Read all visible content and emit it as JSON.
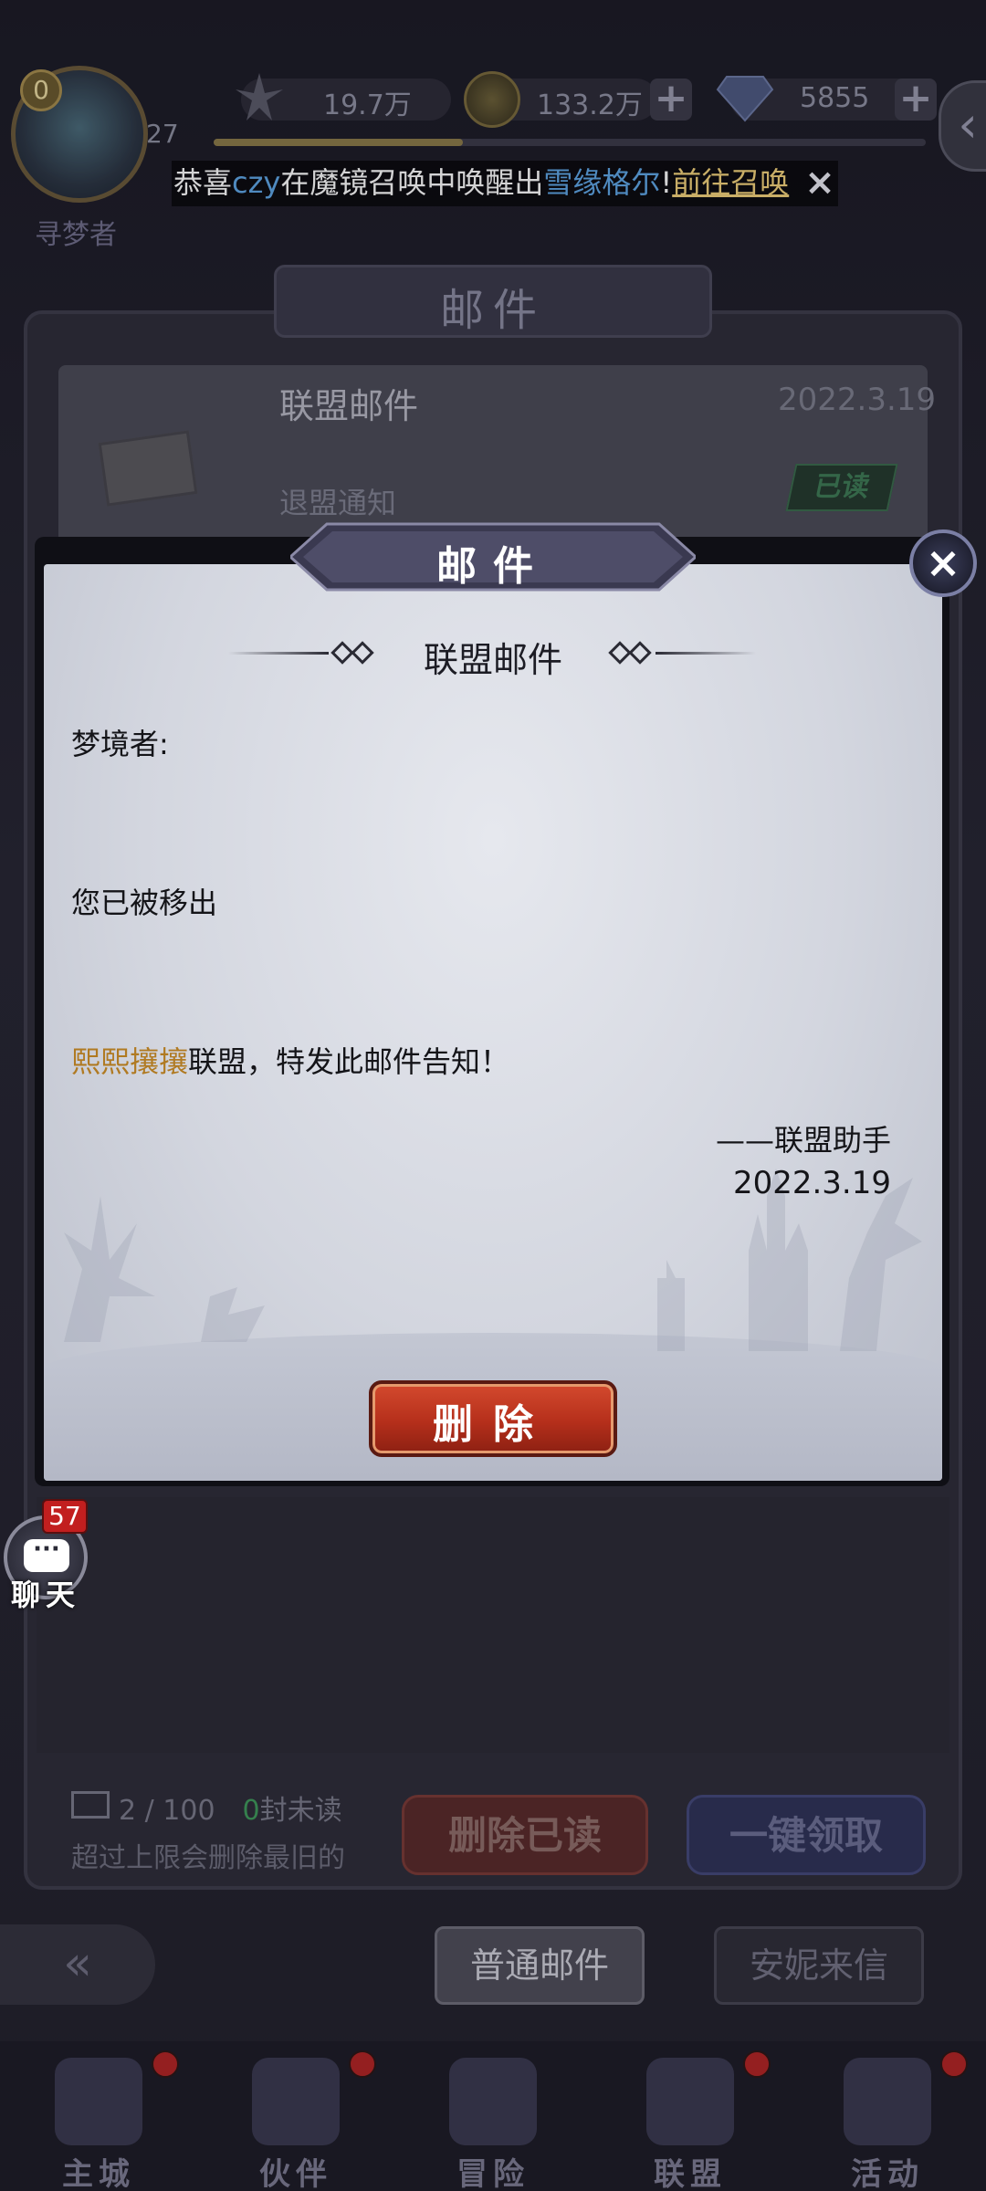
{
  "player": {
    "avatar_level": "0",
    "level": "27",
    "name": "寻梦者"
  },
  "resources": {
    "power": "19.7万",
    "gold": "133.2万",
    "diamonds": "5855"
  },
  "exp_progress": 0.35,
  "ticker": {
    "prefix": "恭喜",
    "player": "czy",
    "middle": "在魔镜召唤中唤醒出",
    "hero": "雪缘格尔",
    "bang": "!",
    "link": "前往召唤",
    "close_icon": "×"
  },
  "mailbox": {
    "title": "邮件",
    "item": {
      "title": "联盟邮件",
      "date": "2022.3.19",
      "subject": "退盟通知",
      "status": "已读"
    },
    "count": "2 / 100",
    "unread_count": "0",
    "unread_label": "封未读",
    "limit_note": "超过上限会删除最旧的",
    "delete_read_label": "删除已读",
    "claim_all_label": "一键领取",
    "tabs": [
      {
        "label": "普通邮件",
        "active": true
      },
      {
        "label": "安妮来信",
        "active": false
      }
    ]
  },
  "dialog": {
    "title": "邮件",
    "close_icon": "×",
    "heading": "联盟邮件",
    "greeting": "梦境者:",
    "line1": "您已被移出",
    "alliance_name": "熙熙攘攘",
    "line2_rest": "联盟，特发此邮件告知！",
    "signature": "——联盟助手",
    "date": "2022.3.19",
    "delete_label": "删除"
  },
  "chat": {
    "badge": "57",
    "label": "聊天",
    "bubble": "···"
  },
  "bottom_nav": [
    {
      "label": "主城",
      "icon": "castle-icon",
      "dot": true
    },
    {
      "label": "伙伴",
      "icon": "witch-hat-icon",
      "dot": true
    },
    {
      "label": "冒险",
      "icon": "compass-icon",
      "dot": false
    },
    {
      "label": "联盟",
      "icon": "shield-icon",
      "dot": true
    },
    {
      "label": "活动",
      "icon": "cards-icon",
      "dot": true
    }
  ],
  "colors": {
    "highlight": "#b07a22",
    "ticker_blue": "#5fa6e6",
    "ticker_link": "#f3d27a",
    "delete_red": "#c23a22"
  }
}
